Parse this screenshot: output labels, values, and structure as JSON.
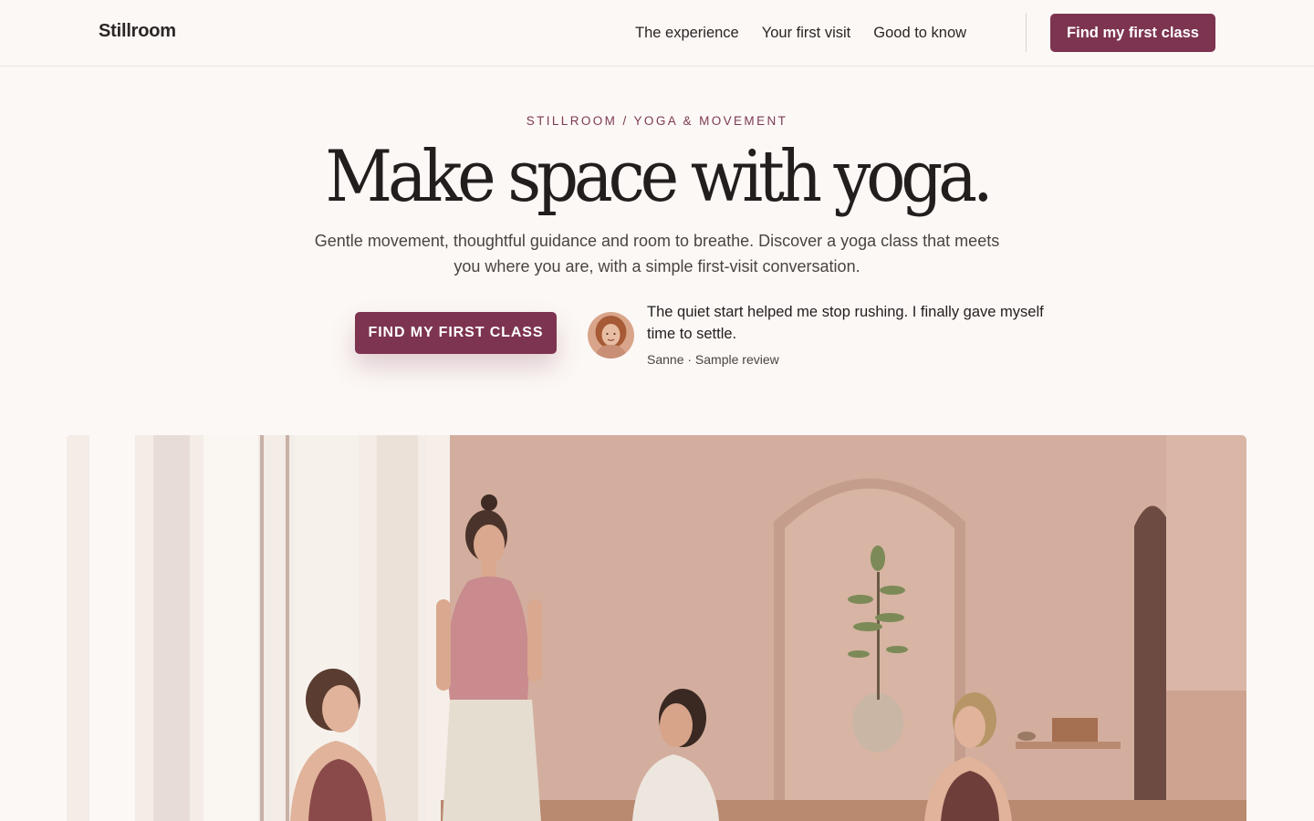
{
  "header": {
    "brand": "Stillroom",
    "nav": [
      {
        "label": "The experience"
      },
      {
        "label": "Your first visit"
      },
      {
        "label": "Good to know"
      }
    ],
    "cta_label": "Find my first class"
  },
  "hero": {
    "eyebrow": "STILLROOM / YOGA & MOVEMENT",
    "title": "Make space with yoga.",
    "subtitle": "Gentle movement, thoughtful guidance and room to breathe. Discover a yoga class that meets you where you are, with a simple first-visit conversation.",
    "cta_label": "FIND MY FIRST CLASS",
    "testimonial": {
      "quote": "The quiet start helped me stop rushing. I finally gave myself time to settle.",
      "meta": "Sanne · Sample review"
    }
  },
  "colors": {
    "accent": "#7d3450",
    "background": "#fcf8f5",
    "eyebrow": "#7d3a55",
    "text": "#231e1e"
  },
  "icons": {
    "avatar": "reviewer-avatar-photo"
  }
}
